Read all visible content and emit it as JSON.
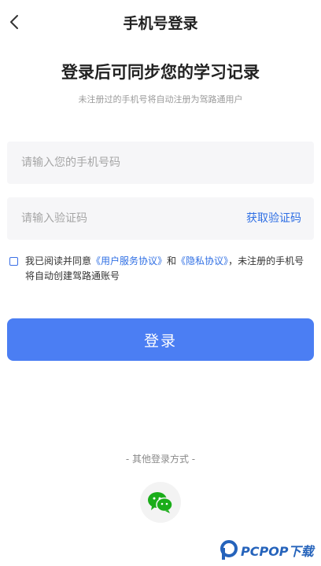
{
  "header": {
    "title": "手机号登录",
    "back_icon": "chevron-left-icon"
  },
  "main": {
    "heading": "登录后可同步您的学习记录",
    "subheading": "未注册过的手机号将自动注册为驾路通用户"
  },
  "form": {
    "phone_placeholder": "请输入您的手机号码",
    "code_placeholder": "请输入验证码",
    "get_code_label": "获取验证码"
  },
  "agreement": {
    "checked": false,
    "prefix": "我已阅读并同意",
    "service_link": "《用户服务协议》",
    "and": "和",
    "privacy_link": "《隐私协议》",
    "suffix": "，未注册的手机号将自动创建驾路通账号"
  },
  "login_button": "登录",
  "other_login": {
    "label": "- 其他登录方式 -",
    "wechat_icon": "wechat-icon"
  },
  "watermark": {
    "text": "PCPOP下载"
  },
  "colors": {
    "accent": "#4b7ef3",
    "link": "#2f6fe4",
    "wechat": "#1aad19",
    "field_bg": "#f6f6f8"
  }
}
